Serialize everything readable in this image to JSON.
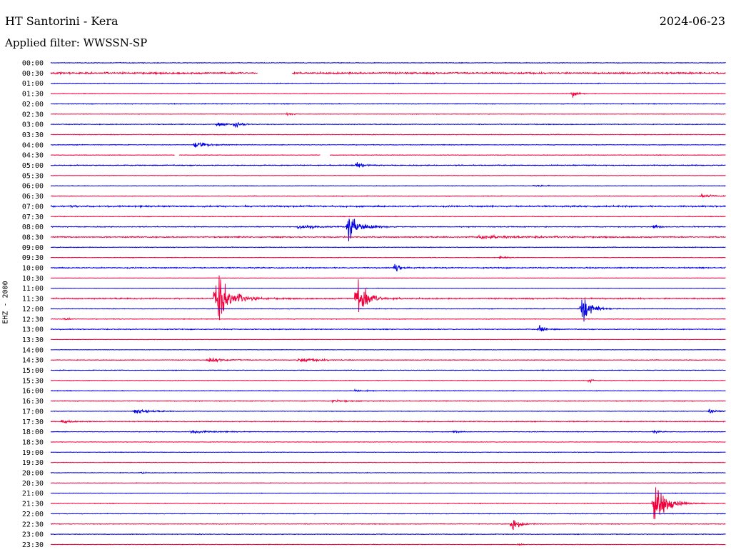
{
  "header": {
    "title": "HT Santorini - Kera",
    "date": "2024-06-23",
    "filter": "Applied filter: WWSSN-SP"
  },
  "colors": {
    "odd": "#0000e6",
    "even": "#f0003c"
  },
  "chart_data": {
    "type": "line",
    "title": "HT Santorini - Kera",
    "subtitle": "Applied filter: WWSSN-SP",
    "ylabel": "EHZ - 2000",
    "xlabel": "",
    "rows": [
      "00:00",
      "00:30",
      "01:00",
      "01:30",
      "02:00",
      "02:30",
      "03:00",
      "03:30",
      "04:00",
      "04:30",
      "05:00",
      "05:30",
      "06:00",
      "06:30",
      "07:00",
      "07:30",
      "08:00",
      "08:30",
      "09:00",
      "09:30",
      "10:00",
      "10:30",
      "11:00",
      "11:30",
      "12:00",
      "12:30",
      "13:00",
      "13:30",
      "14:00",
      "14:30",
      "15:00",
      "15:30",
      "16:00",
      "16:30",
      "17:00",
      "17:30",
      "18:00",
      "18:30",
      "19:00",
      "19:30",
      "20:00",
      "20:30",
      "21:00",
      "21:30",
      "22:00",
      "22:30",
      "23:00",
      "23:30"
    ],
    "x_range_minutes": [
      0,
      30
    ],
    "noise_level": [
      0.6,
      1.6,
      0.6,
      0.5,
      0.7,
      0.5,
      0.7,
      0.6,
      0.6,
      0.5,
      0.9,
      0.4,
      0.5,
      0.6,
      1.4,
      0.6,
      0.8,
      1.1,
      0.6,
      0.5,
      1.0,
      0.4,
      0.4,
      1.2,
      0.6,
      0.6,
      0.8,
      0.4,
      0.4,
      0.6,
      0.6,
      0.5,
      0.6,
      0.7,
      0.5,
      0.8,
      0.6,
      0.5,
      0.5,
      0.5,
      0.6,
      0.5,
      0.5,
      0.6,
      0.6,
      0.6,
      0.6,
      0.5
    ],
    "events": [
      {
        "row": 3,
        "minute": 23.2,
        "amp": 8,
        "dur": 0.6
      },
      {
        "row": 5,
        "minute": 10.5,
        "amp": 3,
        "dur": 0.5
      },
      {
        "row": 6,
        "minute": 7.4,
        "amp": 5,
        "dur": 0.8
      },
      {
        "row": 6,
        "minute": 8.2,
        "amp": 8,
        "dur": 0.7
      },
      {
        "row": 8,
        "minute": 6.4,
        "amp": 9,
        "dur": 1.2
      },
      {
        "row": 10,
        "minute": 13.6,
        "amp": 7,
        "dur": 0.6
      },
      {
        "row": 12,
        "minute": 21.5,
        "amp": 2,
        "dur": 1.2
      },
      {
        "row": 13,
        "minute": 28.9,
        "amp": 4,
        "dur": 1.5
      },
      {
        "row": 16,
        "minute": 13.2,
        "amp": 28,
        "dur": 1.3
      },
      {
        "row": 16,
        "minute": 11.0,
        "amp": 5,
        "dur": 2.2
      },
      {
        "row": 16,
        "minute": 26.8,
        "amp": 6,
        "dur": 0.5
      },
      {
        "row": 17,
        "minute": 19.0,
        "amp": 3,
        "dur": 5.0
      },
      {
        "row": 19,
        "minute": 20.0,
        "amp": 2,
        "dur": 0.8
      },
      {
        "row": 20,
        "minute": 15.3,
        "amp": 9,
        "dur": 0.6
      },
      {
        "row": 23,
        "minute": 7.3,
        "amp": 62,
        "dur": 1.5
      },
      {
        "row": 23,
        "minute": 13.6,
        "amp": 45,
        "dur": 1.2
      },
      {
        "row": 24,
        "minute": 23.6,
        "amp": 36,
        "dur": 1.0
      },
      {
        "row": 25,
        "minute": 0.6,
        "amp": 3,
        "dur": 0.6
      },
      {
        "row": 26,
        "minute": 21.7,
        "amp": 8,
        "dur": 0.8
      },
      {
        "row": 29,
        "minute": 7.0,
        "amp": 4,
        "dur": 2.0
      },
      {
        "row": 29,
        "minute": 11.0,
        "amp": 4,
        "dur": 2.5
      },
      {
        "row": 31,
        "minute": 23.9,
        "amp": 3,
        "dur": 0.6
      },
      {
        "row": 32,
        "minute": 13.5,
        "amp": 2,
        "dur": 1.5
      },
      {
        "row": 33,
        "minute": 12.5,
        "amp": 2,
        "dur": 2.5
      },
      {
        "row": 34,
        "minute": 3.7,
        "amp": 5,
        "dur": 1.8
      },
      {
        "row": 34,
        "minute": 29.3,
        "amp": 5,
        "dur": 1.0
      },
      {
        "row": 35,
        "minute": 0.5,
        "amp": 4,
        "dur": 1.0
      },
      {
        "row": 36,
        "minute": 6.2,
        "amp": 3,
        "dur": 2.5
      },
      {
        "row": 36,
        "minute": 17.9,
        "amp": 4,
        "dur": 0.5
      },
      {
        "row": 36,
        "minute": 26.8,
        "amp": 3,
        "dur": 0.6
      },
      {
        "row": 40,
        "minute": 4.0,
        "amp": 3,
        "dur": 0.3
      },
      {
        "row": 43,
        "minute": 26.8,
        "amp": 70,
        "dur": 1.2
      },
      {
        "row": 45,
        "minute": 20.5,
        "amp": 14,
        "dur": 0.8
      },
      {
        "row": 47,
        "minute": 20.8,
        "amp": 4,
        "dur": 0.3
      }
    ],
    "gaps": [
      {
        "row": 1,
        "from": 9.2,
        "to": 10.7
      },
      {
        "row": 9,
        "from": 5.5,
        "to": 5.7
      },
      {
        "row": 9,
        "from": 12.0,
        "to": 12.4
      }
    ],
    "grid": false,
    "legend": "none"
  }
}
